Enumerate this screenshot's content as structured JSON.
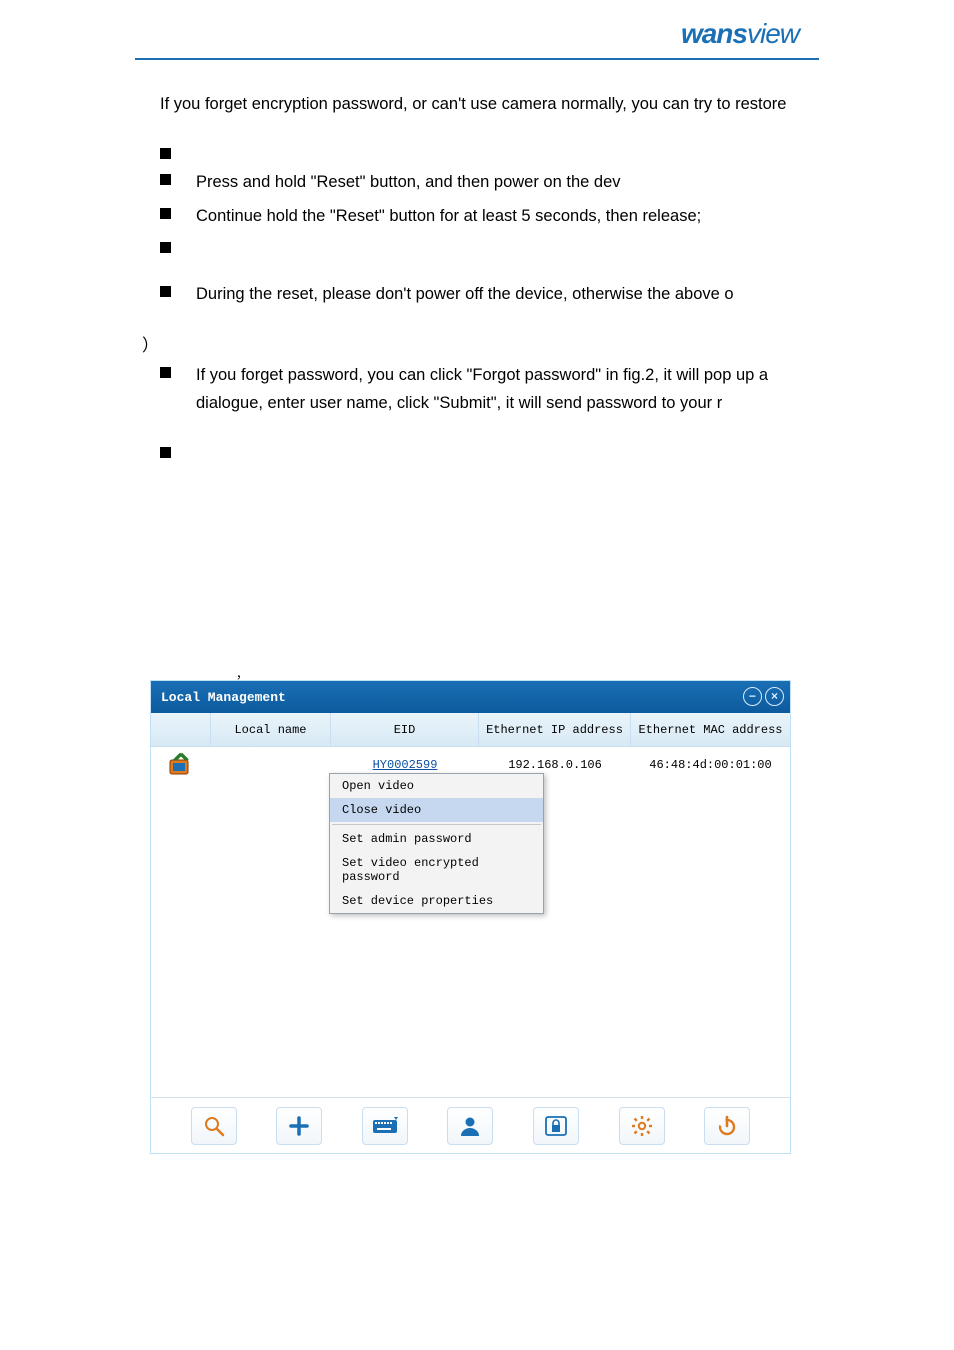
{
  "logo_text": "wansview",
  "doc": {
    "para1": "If you forget encryption password, or can't use camera normally, you can try to restore",
    "bul1": "",
    "bul2": "Press and hold \"Reset\" button, and then power on the dev",
    "bul3": "Continue hold the \"Reset\" button for at least 5 seconds, then release;",
    "bul4": "",
    "bul5": "During the reset, please don't power off the device, otherwise the above o",
    "paren": "）",
    "bul6": "If you forget password, you can click \"Forgot password\" in fig.2, it will pop up a dialogue, enter user name, click \"Submit\", it will send password to your r",
    "bul7": "",
    "comma": "，"
  },
  "app": {
    "title": "Local Management",
    "headers": {
      "h1": "Local name",
      "h2": "EID",
      "h3": "Ethernet IP address",
      "h4": "Ethernet MAC address"
    },
    "row": {
      "eid": "HY0002599",
      "ip": "192.168.0.106",
      "mac": "46:48:4d:00:01:00"
    },
    "context_menu": {
      "m1": "Open video",
      "m2": "Close video",
      "m3": "Set admin password",
      "m4": "Set video encrypted password",
      "m5": "Set device properties"
    },
    "toolbar": {
      "search": "search",
      "add": "add",
      "keyboard": "keyboard",
      "user": "user",
      "lock": "lock",
      "gear": "settings",
      "power": "power"
    }
  }
}
